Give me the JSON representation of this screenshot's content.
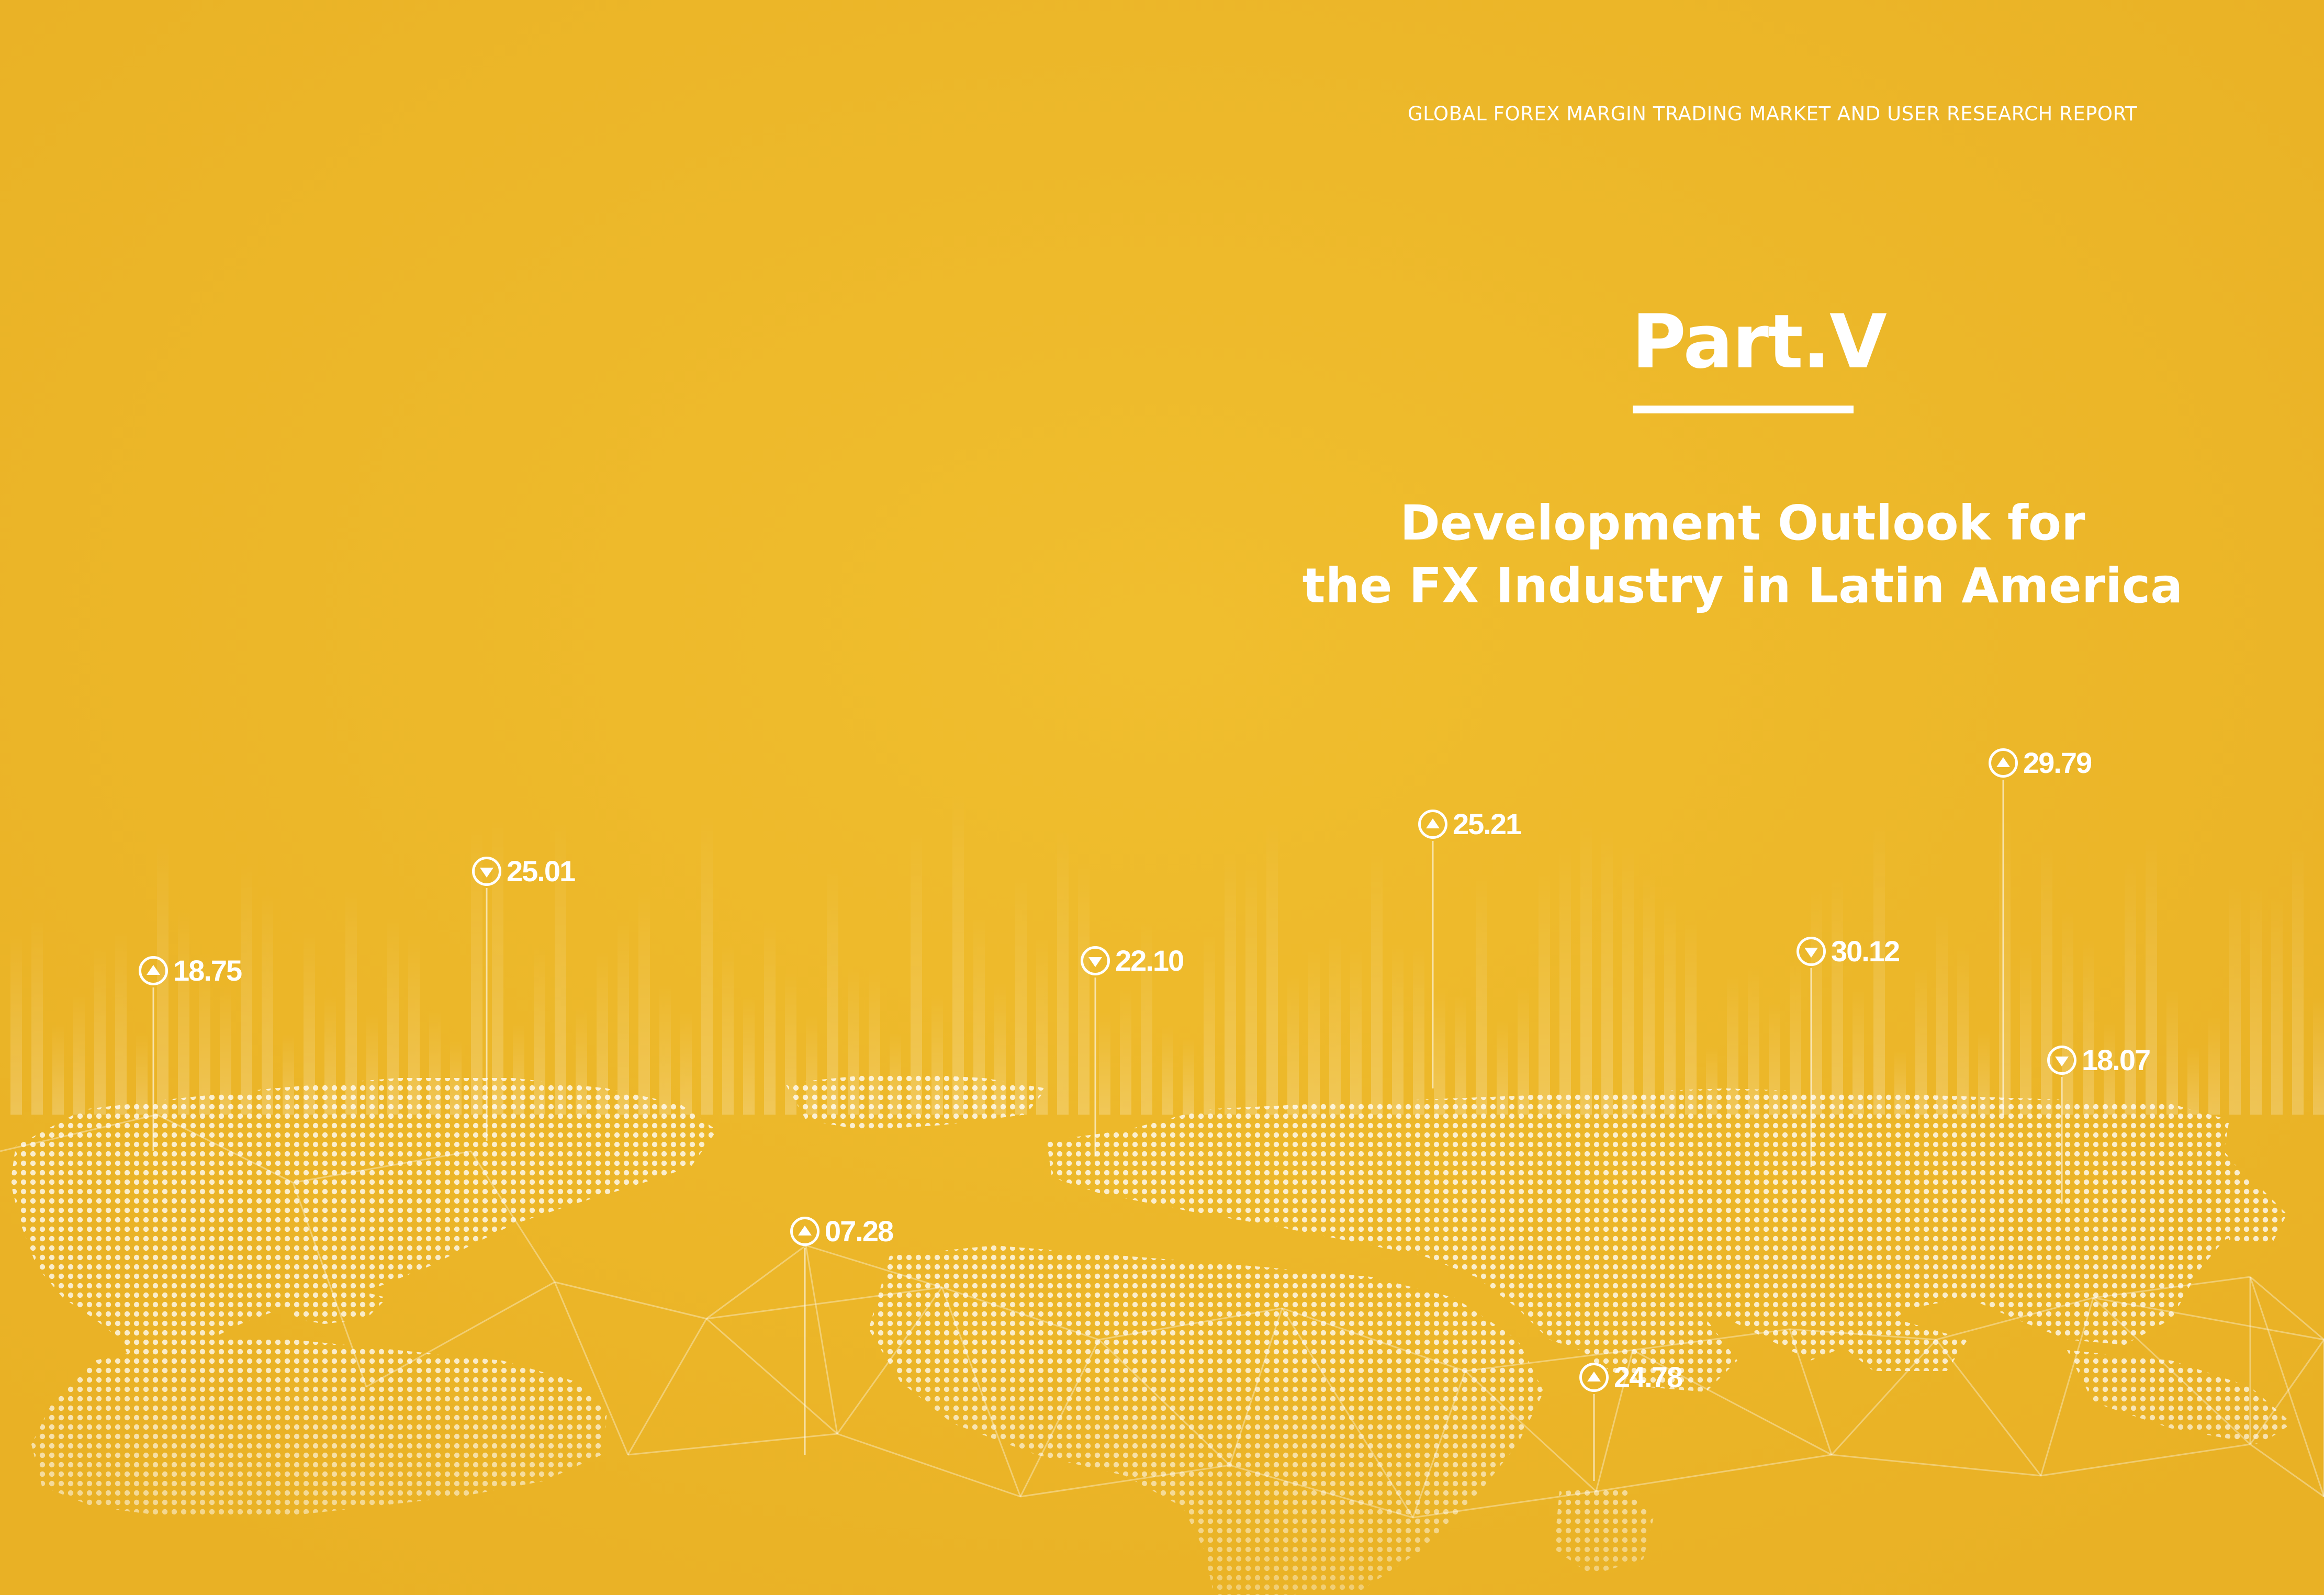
{
  "header": {
    "report_title": "GLOBAL FOREX MARGIN TRADING MARKET AND USER RESEARCH REPORT"
  },
  "part": {
    "title": "Part.V"
  },
  "section": {
    "title_line1": "Development Outlook for",
    "title_line2": "the FX Industry in Latin America"
  },
  "map_markers": [
    {
      "value": "18.75",
      "direction": "up",
      "icon": "arrow-up-circle-icon"
    },
    {
      "value": "25.01",
      "direction": "down",
      "icon": "arrow-down-circle-icon"
    },
    {
      "value": "07.28",
      "direction": "up",
      "icon": "arrow-up-circle-icon"
    },
    {
      "value": "22.10",
      "direction": "down",
      "icon": "arrow-down-circle-icon"
    },
    {
      "value": "25.21",
      "direction": "up",
      "icon": "arrow-up-circle-icon"
    },
    {
      "value": "24.78",
      "direction": "up",
      "icon": "arrow-up-circle-icon"
    },
    {
      "value": "30.12",
      "direction": "down",
      "icon": "arrow-down-circle-icon"
    },
    {
      "value": "29.79",
      "direction": "up",
      "icon": "arrow-up-circle-icon"
    },
    {
      "value": "18.07",
      "direction": "down",
      "icon": "arrow-down-circle-icon"
    }
  ],
  "colors": {
    "background": "#ECB629",
    "foreground": "#FFFFFF"
  }
}
